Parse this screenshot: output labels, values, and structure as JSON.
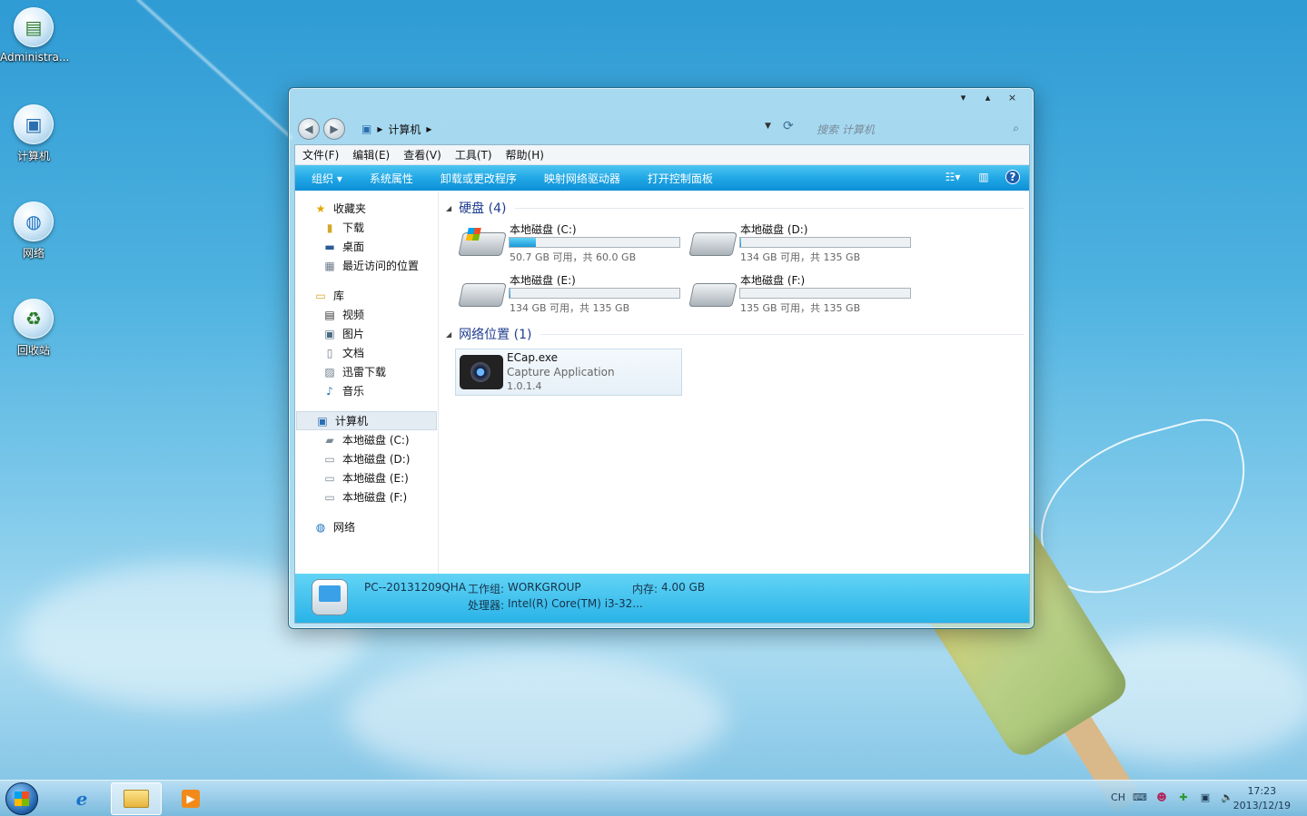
{
  "desktop": {
    "icons": [
      {
        "label": "Administra...",
        "icon": "user-folder-icon"
      },
      {
        "label": "计算机",
        "icon": "computer-icon"
      },
      {
        "label": "网络",
        "icon": "network-icon"
      },
      {
        "label": "回收站",
        "icon": "recycle-bin-icon"
      }
    ]
  },
  "window": {
    "controls": {
      "minimize": "▾",
      "maximize": "▴",
      "close": "×"
    },
    "breadcrumb": {
      "root_sep": "▸",
      "current": "计算机",
      "end_sep": "▸"
    },
    "search_placeholder": "搜索 计算机",
    "menu": [
      "文件(F)",
      "编辑(E)",
      "查看(V)",
      "工具(T)",
      "帮助(H)"
    ],
    "toolbar": {
      "organize": "组织 ▾",
      "items": [
        "系统属性",
        "卸载或更改程序",
        "映射网络驱动器",
        "打开控制面板"
      ]
    },
    "sidebar": {
      "favorites": "收藏夹",
      "favorites_items": [
        "下载",
        "桌面",
        "最近访问的位置"
      ],
      "libraries": "库",
      "libraries_items": [
        "视频",
        "图片",
        "文档",
        "迅雷下载",
        "音乐"
      ],
      "computer": "计算机",
      "computer_items": [
        "本地磁盘 (C:)",
        "本地磁盘 (D:)",
        "本地磁盘 (E:)",
        "本地磁盘 (F:)"
      ],
      "network": "网络"
    },
    "groups": {
      "hard_drives": "硬盘 (4)",
      "network_locations": "网络位置 (1)"
    },
    "drives": [
      {
        "name": "本地磁盘 (C:)",
        "info": "50.7 GB 可用，共 60.0 GB",
        "used_fraction": 0.155
      },
      {
        "name": "本地磁盘 (D:)",
        "info": "134 GB 可用，共 135 GB",
        "used_fraction": 0.007
      },
      {
        "name": "本地磁盘 (E:)",
        "info": "134 GB 可用，共 135 GB",
        "used_fraction": 0.007
      },
      {
        "name": "本地磁盘 (F:)",
        "info": "135 GB 可用，共 135 GB",
        "used_fraction": 0.0
      }
    ],
    "network_item": {
      "name": "ECap.exe",
      "desc": "Capture Application",
      "version": "1.0.1.4"
    },
    "details": {
      "pc_name": "PC--20131209QHA",
      "workgroup_label": "工作组:",
      "workgroup": "WORKGROUP",
      "memory_label": "内存:",
      "memory": "4.00 GB",
      "cpu_label": "处理器:",
      "cpu": "Intel(R) Core(TM) i3-32..."
    }
  },
  "taskbar": {
    "tray_lang": "CH",
    "time": "17:23",
    "date": "2013/12/19"
  }
}
